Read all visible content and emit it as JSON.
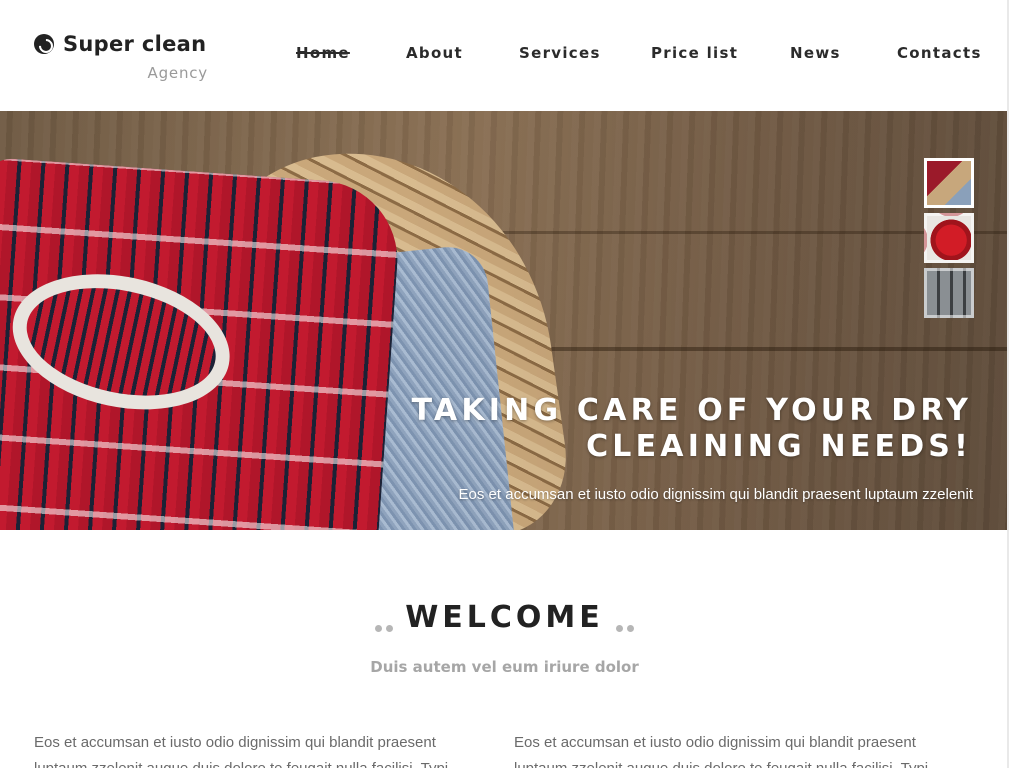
{
  "brand": {
    "name": "Super clean",
    "tagline": "Agency"
  },
  "nav": {
    "items": [
      {
        "label": "Home",
        "active": true
      },
      {
        "label": "About",
        "active": false
      },
      {
        "label": "Services",
        "active": false
      },
      {
        "label": "Price list",
        "active": false
      },
      {
        "label": "News",
        "active": false
      },
      {
        "label": "Contacts",
        "active": false
      }
    ]
  },
  "hero": {
    "title_line1": "TAKING CARE OF YOUR DRY",
    "title_line2": "CLEAINING NEEDS!",
    "subtitle": "Eos et accumsan et iusto odio dignissim qui blandit praesent luptaum zzelenit",
    "thumbnails": [
      {
        "name": "sweater-basket",
        "active": true
      },
      {
        "name": "red-shirt-hanger",
        "active": false
      },
      {
        "name": "washing-machines",
        "active": false
      }
    ]
  },
  "welcome": {
    "title": "WELCOME",
    "subtitle": "Duis autem vel eum iriure dolor",
    "col_left": "Eos et accumsan et iusto odio dignissim qui blandit praesent luptaum zzelenit augue duis dolore te feugait nulla facilisi. Typi",
    "col_right": "Eos et accumsan et iusto odio dignissim qui blandit praesent luptaum zzelenit augue duis dolore te feugait nulla facilisi. Typi"
  },
  "colors": {
    "text_dark": "#222222",
    "text_muted": "#9a9a9a",
    "hero_text": "#ffffff"
  }
}
